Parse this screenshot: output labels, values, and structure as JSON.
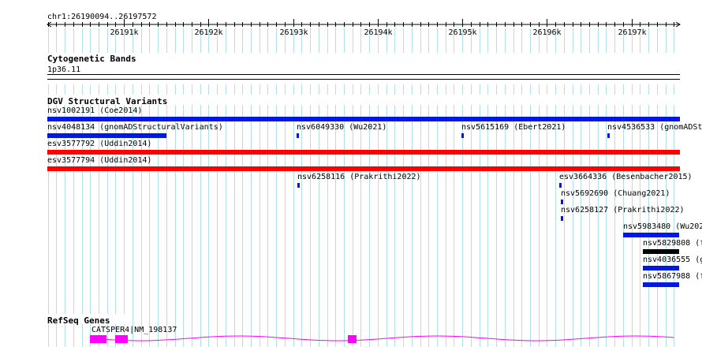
{
  "ruler": {
    "range_label": "chr1:26190094..26197572",
    "ticks": [
      {
        "label": "26191k",
        "pos": 26191000
      },
      {
        "label": "26192k",
        "pos": 26192000
      },
      {
        "label": "26193k",
        "pos": 26193000
      },
      {
        "label": "26194k",
        "pos": 26194000
      },
      {
        "label": "26195k",
        "pos": 26195000
      },
      {
        "label": "26196k",
        "pos": 26196000
      },
      {
        "label": "26197k",
        "pos": 26197000
      }
    ]
  },
  "tracks": {
    "cytoband": {
      "title": "Cytogenetic Bands",
      "band_label": "1p36.11"
    },
    "dgv": {
      "title": "DGV Structural Variants"
    },
    "refseq": {
      "title": "RefSeq Genes",
      "gene_label": "CATSPER4|NM_198137"
    }
  },
  "colors": {
    "gain": "#0018e6",
    "loss": "#ff0000",
    "complex": "#000000",
    "gene": "#ff00ff",
    "grid": "#b2dfe8"
  },
  "variants": [
    {
      "label": "nsv1002191 (Coe2014)",
      "start": 26190094,
      "end": 26197572,
      "type": "gain"
    },
    {
      "label": "nsv4048134 (gnomADStructuralVariants)",
      "start": 26190094,
      "end": 26191500,
      "type": "gain"
    },
    {
      "label": "nsv6049330 (Wu2021)",
      "start": 26193045,
      "end": 26193075,
      "type": "gain"
    },
    {
      "label": "nsv5615169 (Ebert2021)",
      "start": 26194990,
      "end": 26195020,
      "type": "gain"
    },
    {
      "label": "nsv4536533 (gnomADSt",
      "start": 26196716,
      "end": 26196746,
      "type": "gain"
    },
    {
      "label": "esv3577792 (Uddin2014)",
      "start": 26190094,
      "end": 26197572,
      "type": "loss"
    },
    {
      "label": "esv3577794 (Uddin2014)",
      "start": 26190094,
      "end": 26197572,
      "type": "loss"
    },
    {
      "label": "nsv6258116 (Prakrithi2022)",
      "start": 26193050,
      "end": 26193080,
      "type": "gain"
    },
    {
      "label": "esv3664336 (Besenbacher2015)",
      "start": 26196150,
      "end": 26196180,
      "type": "gain"
    },
    {
      "label": "nsv5692690 (Chuang2021)",
      "start": 26196160,
      "end": 26196190,
      "type": "gain"
    },
    {
      "label": "nsv6258127 (Prakrithi2022)",
      "start": 26196160,
      "end": 26196190,
      "type": "gain"
    },
    {
      "label": "nsv5983480 (Wu202",
      "start": 26196900,
      "end": 26197560,
      "type": "gain"
    },
    {
      "label": "nsv5829808 (f",
      "start": 26197130,
      "end": 26197560,
      "type": "complex"
    },
    {
      "label": "nsv4036555 (g",
      "start": 26197130,
      "end": 26197560,
      "type": "gain"
    },
    {
      "label": "nsv5867988 (f",
      "start": 26197130,
      "end": 26197560,
      "type": "gain"
    }
  ],
  "gene": {
    "start": 26190600,
    "end": 26197572,
    "exons": [
      {
        "start": 26190600,
        "end": 26190800
      },
      {
        "start": 26190900,
        "end": 26191050
      },
      {
        "start": 26193650,
        "end": 26193750
      }
    ]
  }
}
